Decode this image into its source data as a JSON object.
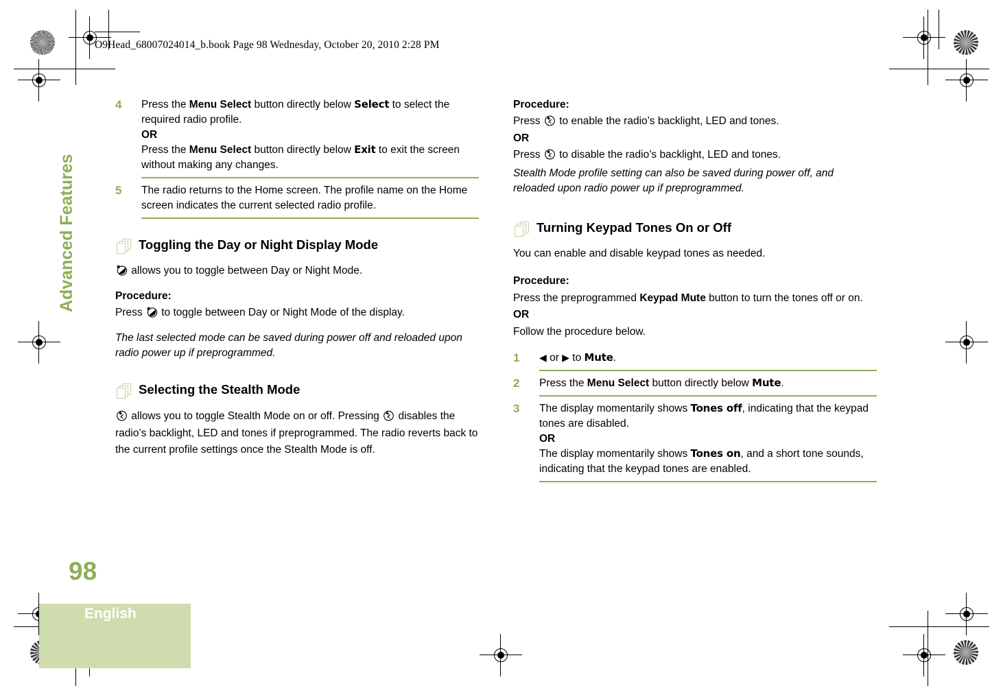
{
  "header": {
    "book_line": "O9Head_68007024014_b.book  Page 98  Wednesday, October 20, 2010  2:28 PM"
  },
  "side_tab": {
    "label": "Advanced Features"
  },
  "footer": {
    "page_number": "98",
    "language": "English"
  },
  "colors": {
    "accent_green": "#8fae57",
    "box_green": "#cedcae",
    "icon_outline_green": "#c3d4a3"
  },
  "left_column": {
    "steps": [
      {
        "num": "4",
        "lines": [
          {
            "type": "mixed",
            "parts": [
              {
                "t": "Press the ",
                "s": "plain"
              },
              {
                "t": "Menu Select",
                "s": "bold"
              },
              {
                "t": " button directly below ",
                "s": "plain"
              },
              {
                "t": "Select",
                "s": "display"
              },
              {
                "t": " to select the required radio profile.",
                "s": "plain"
              }
            ]
          },
          {
            "type": "or",
            "t": "OR"
          },
          {
            "type": "mixed",
            "parts": [
              {
                "t": "Press the ",
                "s": "plain"
              },
              {
                "t": "Menu Select",
                "s": "bold"
              },
              {
                "t": " button directly below ",
                "s": "plain"
              },
              {
                "t": "Exit",
                "s": "display"
              },
              {
                "t": " to exit the screen without making any changes.",
                "s": "plain"
              }
            ]
          }
        ]
      },
      {
        "num": "5",
        "lines": [
          {
            "type": "mixed",
            "parts": [
              {
                "t": "The radio returns to the Home screen. The profile name on the Home screen indicates the current selected radio profile.",
                "s": "plain"
              }
            ]
          }
        ]
      }
    ],
    "section_day_night": {
      "heading": "Toggling the Day or Night Display Mode",
      "icon": "day-night-mode-icon",
      "intro_suffix": " allows you to toggle between Day or Night Mode.",
      "procedure_label": "Procedure:",
      "procedure_prefix": "Press ",
      "procedure_suffix": " to toggle between Day or Night Mode of the display.",
      "note": "The last selected mode can be saved during power off and reloaded upon radio power up if preprogrammed."
    },
    "section_stealth": {
      "heading": "Selecting the Stealth Mode",
      "icon": "stealth-mode-icon",
      "text_a": " allows you to toggle Stealth Mode on or off. Pressing ",
      "text_b": " disables the radio’s backlight, LED and tones if preprogrammed. The radio reverts back to the current profile settings once the Stealth Mode is off."
    }
  },
  "right_column": {
    "stealth_procedure": {
      "procedure_label": "Procedure:",
      "press_prefix": "Press ",
      "enable_suffix": " to enable the radio’s backlight, LED and tones.",
      "or": "OR",
      "disable_suffix": " to disable the radio’s backlight, LED and tones.",
      "note": "Stealth Mode profile setting can also be saved during power off, and reloaded upon radio power up if preprogrammed."
    },
    "section_keypad_tones": {
      "heading": "Turning Keypad Tones On or Off",
      "intro": "You can enable and disable keypad tones as needed.",
      "procedure_label": "Procedure:",
      "procedure_parts": [
        {
          "t": "Press the preprogrammed ",
          "s": "plain"
        },
        {
          "t": "Keypad Mute",
          "s": "bold"
        },
        {
          "t": " button to turn the tones off or on.",
          "s": "plain"
        }
      ],
      "or": "OR",
      "follow": "Follow the procedure below.",
      "steps": [
        {
          "num": "1",
          "parts": [
            {
              "t": "◀",
              "s": "arrow"
            },
            {
              "t": " or ",
              "s": "plain"
            },
            {
              "t": "▶",
              "s": "arrow"
            },
            {
              "t": " to ",
              "s": "plain"
            },
            {
              "t": "Mute",
              "s": "display"
            },
            {
              "t": ".",
              "s": "plain"
            }
          ]
        },
        {
          "num": "2",
          "parts": [
            {
              "t": "Press the ",
              "s": "plain"
            },
            {
              "t": "Menu Select",
              "s": "bold"
            },
            {
              "t": " button directly below ",
              "s": "plain"
            },
            {
              "t": "Mute",
              "s": "display"
            },
            {
              "t": ".",
              "s": "plain"
            }
          ]
        },
        {
          "num": "3",
          "parts": [
            {
              "t": "The display momentarily shows ",
              "s": "plain"
            },
            {
              "t": "Tones off",
              "s": "display"
            },
            {
              "t": ", indicating that the keypad tones are disabled.",
              "s": "plain"
            },
            {
              "t": "OR",
              "s": "or-line"
            },
            {
              "t": "The display momentarily shows ",
              "s": "plain"
            },
            {
              "t": "Tones on",
              "s": "display"
            },
            {
              "t": ", and a short tone sounds, indicating that the keypad tones are enabled.",
              "s": "plain"
            }
          ]
        }
      ]
    }
  },
  "icons": {
    "day_night": "day-night-mode-icon",
    "stealth": "stealth-mode-icon",
    "left_arrow": "◀",
    "right_arrow": "▶",
    "registration": "registration-crosshair-icon",
    "starburst": "starburst-calibration-icon"
  }
}
